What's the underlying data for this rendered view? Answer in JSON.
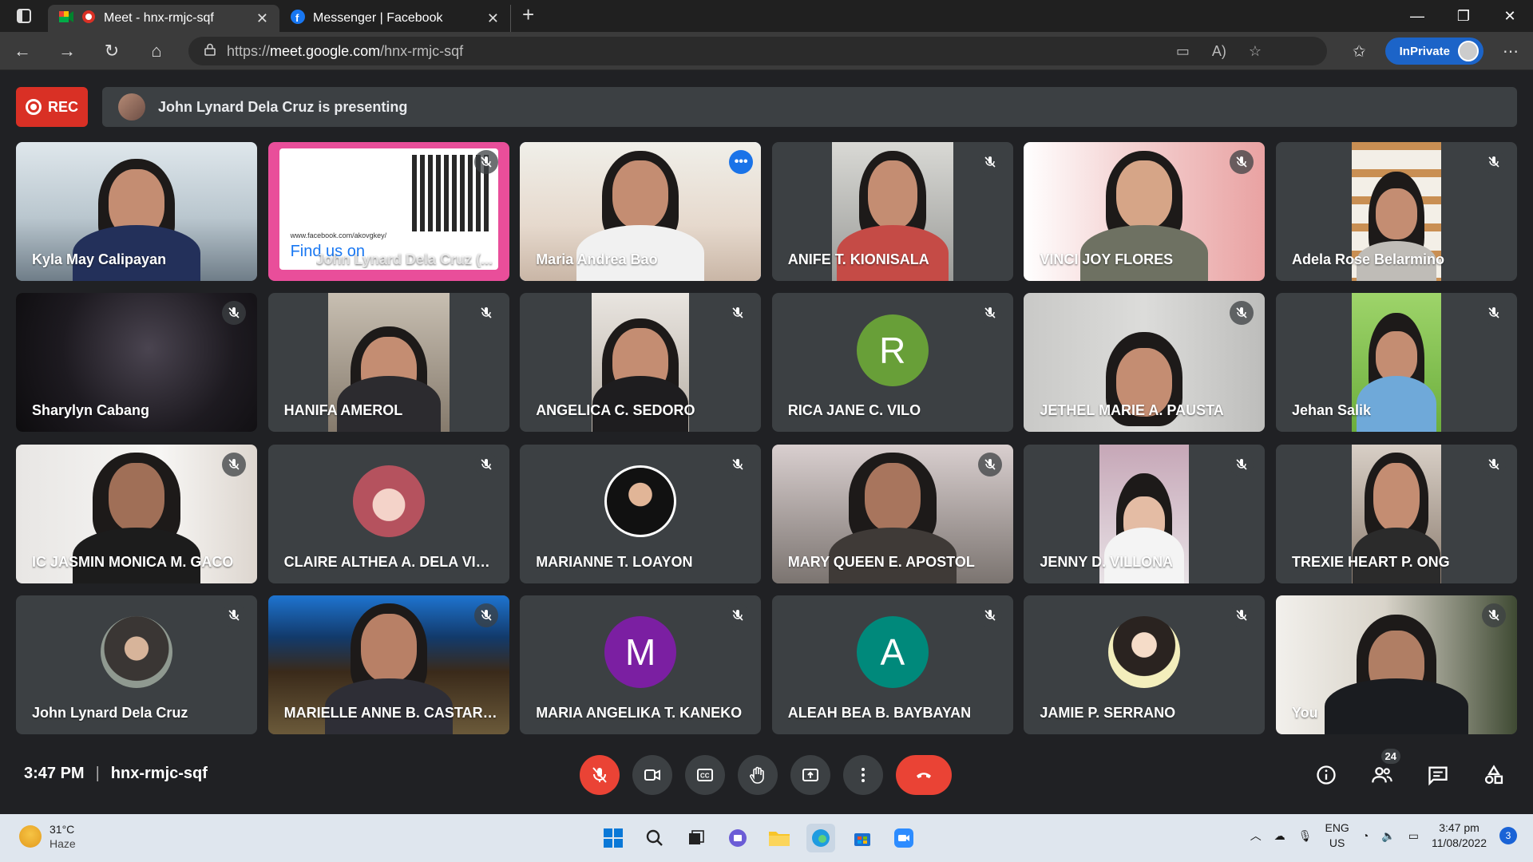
{
  "browser": {
    "tabs": [
      {
        "title": "Meet - hnx-rmjc-sqf",
        "active": true
      },
      {
        "title": "Messenger | Facebook",
        "active": false
      }
    ],
    "url_prefix": "https://",
    "url_host": "meet.google.com",
    "url_path": "/hnx-rmjc-sqf",
    "inprivate_label": "InPrivate"
  },
  "meet": {
    "rec_label": "REC",
    "presenting_text": "John Lynard Dela Cruz is presenting",
    "meeting_time": "3:47 PM",
    "meeting_code": "hnx-rmjc-sqf",
    "participant_count": "24",
    "colors": {
      "background": "#202124",
      "tile": "#3c4043",
      "red": "#ea4335",
      "accent": "#1a73e8"
    }
  },
  "presentation_tile": {
    "url_text": "www.facebook.com/akovgkey/",
    "find_us_text": "Find us on",
    "overlay_name": "John Lynard Dela Cruz (..."
  },
  "participants": [
    {
      "name": "Kyla May Calipayan",
      "muted": false
    },
    {
      "name": "John Lynard Dela Cruz (Presentation)",
      "muted": true
    },
    {
      "name": "Maria Andrea Bao",
      "muted": false
    },
    {
      "name": "ANIFE T. KIONISALA",
      "muted": true
    },
    {
      "name": "VINCI JOY FLORES",
      "muted": true
    },
    {
      "name": "Adela Rose Belarmino",
      "muted": true
    },
    {
      "name": "Sharylyn Cabang",
      "muted": true
    },
    {
      "name": "HANIFA AMEROL",
      "muted": true
    },
    {
      "name": "ANGELICA C. SEDORO",
      "muted": true
    },
    {
      "name": "RICA JANE C. VILO",
      "muted": true,
      "letter": "R"
    },
    {
      "name": "JETHEL MARIE A. PAUSTA",
      "muted": true
    },
    {
      "name": "Jehan Salik",
      "muted": true
    },
    {
      "name": "IC JASMIN MONICA M. GACO",
      "muted": true
    },
    {
      "name": "CLAIRE ALTHEA A. DELA VICT...",
      "muted": true
    },
    {
      "name": "MARIANNE T. LOAYON",
      "muted": true
    },
    {
      "name": "MARY QUEEN E. APOSTOL",
      "muted": true
    },
    {
      "name": "JENNY D. VILLONA",
      "muted": true
    },
    {
      "name": "TREXIE HEART P. ONG",
      "muted": true
    },
    {
      "name": "John Lynard Dela Cruz",
      "muted": true
    },
    {
      "name": "MARIELLE ANNE B. CASTARDO",
      "muted": true
    },
    {
      "name": "MARIA ANGELIKA T. KANEKO",
      "muted": true,
      "letter": "M"
    },
    {
      "name": "ALEAH BEA B. BAYBAYAN",
      "muted": true,
      "letter": "A"
    },
    {
      "name": "JAMIE P. SERRANO",
      "muted": true
    },
    {
      "name": "You",
      "muted": true
    }
  ],
  "taskbar": {
    "temperature": "31°C",
    "weather": "Haze",
    "lang_top": "ENG",
    "lang_bottom": "US",
    "time": "3:47 pm",
    "date": "11/08/2022",
    "notifications": "3"
  }
}
